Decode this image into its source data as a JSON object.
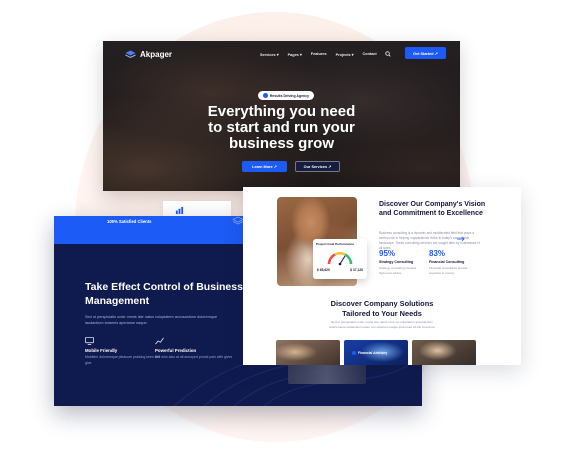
{
  "colors": {
    "accent": "#1c5bf5",
    "dark_navy": "#0f1a4f",
    "blob": "#fbe7e0"
  },
  "hero": {
    "logo": "Akpager",
    "nav": [
      "Services ▾",
      "Pages ▾",
      "Features",
      "Projects ▾",
      "Contact"
    ],
    "cta": "Get Started ↗",
    "badge": "Results Driving Agency",
    "title_line1": "Everything you need",
    "title_line2": "to start and run your",
    "title_line3": "business grow",
    "button_primary": "Learn More ↗",
    "button_secondary": "Our Services ↗"
  },
  "dark_card": {
    "stat": "105% Satisfied Clients",
    "title": "Take Effect Control of Business Management",
    "desc": "Sed ut perspiciatis unde omnis iste natus voluptatem accusantium doloremque laudantium totamris aperiame eaque.",
    "features": [
      {
        "icon": "monitor-icon",
        "title": "Mobile Friendly",
        "desc": "Mobilem doloremque pleasure praising keen will give"
      },
      {
        "icon": "chart-icon",
        "title": "Powerful Prediction",
        "desc": "But who also at all annoyed provid pain with gives"
      }
    ]
  },
  "about_card": {
    "perf_title": "Project Goal Performance",
    "perf_val1": "$ 65,620",
    "perf_val2": "$ 37,120",
    "title": "Discover Our Company's Vision and Commitment to Excellence",
    "desc": "Business consulting is a dynamic and multifaceted field that plays a central role in helping organizations thrive in today's competitive landscape. These consulting services are sought after by businesses of all sizes.",
    "stats": [
      {
        "value": "95%",
        "label": "Strategy Consulting",
        "desc": "Strategy consulting involves high-level advice"
      },
      {
        "value": "83%",
        "label": "Financial Consulting",
        "desc": "Financial consultants provide expertise in money"
      }
    ],
    "solutions_title_line1": "Discover Company Solutions",
    "solutions_title_line2": "Tailored to Your Needs",
    "solutions_desc": "Sed ut perspiciatis unde omnis iste natus error sit voluptatem accusantium doloremque laudantium totam rem aperiam eaque ipsa quae ab illo inventore",
    "solution_cards": [
      {
        "label": ""
      },
      {
        "label": "Financial Advisory"
      },
      {
        "label": ""
      }
    ]
  }
}
